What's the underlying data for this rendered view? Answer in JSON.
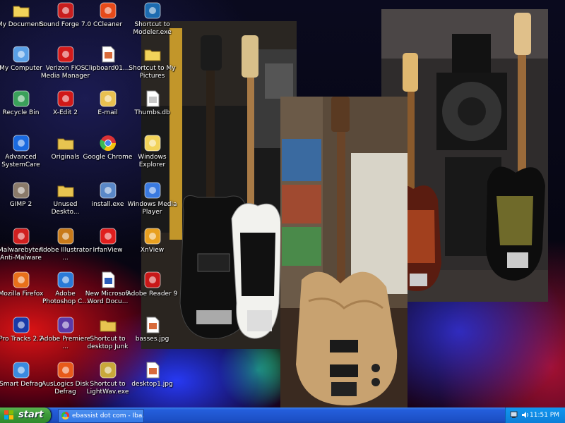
{
  "desktop": {
    "icons": [
      {
        "name": "my-documents",
        "label": "My Documents",
        "icon": "folder-docs-icon"
      },
      {
        "name": "sound-forge",
        "label": "Sound Forge 7.0",
        "icon": "sound-forge-icon"
      },
      {
        "name": "ccleaner",
        "label": "CCleaner",
        "icon": "ccleaner-icon"
      },
      {
        "name": "modeler-shortcut",
        "label": "Shortcut to Modeler.exe",
        "icon": "modeler-icon"
      },
      {
        "name": "my-computer",
        "label": "My Computer",
        "icon": "computer-icon"
      },
      {
        "name": "verizon-fios",
        "label": "Verizon FiOS Media Manager",
        "icon": "verizon-icon"
      },
      {
        "name": "clipboard",
        "label": "Clipboard01....",
        "icon": "image-file-icon"
      },
      {
        "name": "my-pictures-shortcut",
        "label": "Shortcut to My Pictures",
        "icon": "folder-pictures-icon"
      },
      {
        "name": "recycle-bin",
        "label": "Recycle Bin",
        "icon": "recycle-bin-icon"
      },
      {
        "name": "x-edit",
        "label": "X-Edit 2",
        "icon": "x-edit-icon"
      },
      {
        "name": "email",
        "label": "E-mail",
        "icon": "email-icon"
      },
      {
        "name": "thumbs-db",
        "label": "Thumbs.db",
        "icon": "db-file-icon"
      },
      {
        "name": "advanced-systemcare",
        "label": "Advanced SystemCare",
        "icon": "systemcare-icon"
      },
      {
        "name": "originals",
        "label": "Originals",
        "icon": "folder-icon"
      },
      {
        "name": "google-chrome",
        "label": "Google Chrome",
        "icon": "chrome-icon"
      },
      {
        "name": "windows-explorer",
        "label": "Windows Explorer",
        "icon": "explorer-icon"
      },
      {
        "name": "gimp",
        "label": "GIMP 2",
        "icon": "gimp-icon"
      },
      {
        "name": "unused-desktop",
        "label": "Unused Deskto...",
        "icon": "folder-icon"
      },
      {
        "name": "install-exe",
        "label": "install.exe",
        "icon": "installer-icon"
      },
      {
        "name": "windows-media-player",
        "label": "Windows Media Player",
        "icon": "media-player-icon"
      },
      {
        "name": "malwarebytes",
        "label": "Malwarebytes' Anti-Malware",
        "icon": "malwarebytes-icon"
      },
      {
        "name": "adobe-illustrator",
        "label": "Adobe Illustrator ...",
        "icon": "illustrator-icon"
      },
      {
        "name": "irfanview",
        "label": "IrfanView",
        "icon": "irfanview-icon"
      },
      {
        "name": "xnview",
        "label": "XnView",
        "icon": "xnview-icon"
      },
      {
        "name": "mozilla-firefox",
        "label": "Mozilla Firefox",
        "icon": "firefox-icon"
      },
      {
        "name": "adobe-photoshop",
        "label": "Adobe Photoshop C...",
        "icon": "photoshop-icon"
      },
      {
        "name": "new-word-doc",
        "label": "New Microsoft Word Docu...",
        "icon": "word-doc-icon"
      },
      {
        "name": "adobe-reader",
        "label": "Adobe Reader 9",
        "icon": "adobe-reader-icon"
      },
      {
        "name": "pro-tracks",
        "label": "Pro Tracks 2.2",
        "icon": "pro-tracks-icon"
      },
      {
        "name": "adobe-premiere",
        "label": "Adobe Premiere ...",
        "icon": "premiere-icon"
      },
      {
        "name": "desktop-junk-shortcut",
        "label": "Shortcut to desktop Junk",
        "icon": "folder-icon"
      },
      {
        "name": "basses-jpg",
        "label": "basses.jpg",
        "icon": "image-file-icon"
      },
      {
        "name": "smart-defrag",
        "label": "Smart Defrag",
        "icon": "smart-defrag-icon"
      },
      {
        "name": "auslogics-defrag",
        "label": "AusLogics Disk Defrag",
        "icon": "auslogics-icon"
      },
      {
        "name": "lightwav-shortcut",
        "label": "Shortcut to LightWav.exe",
        "icon": "lightwave-icon"
      },
      {
        "name": "desktop1-jpg",
        "label": "desktop1.jpg",
        "icon": "image-file-icon"
      }
    ]
  },
  "taskbar": {
    "start_label": "start",
    "tasks": [
      {
        "label": "ebassist dot com - Iba...",
        "icon": "chrome-icon"
      }
    ],
    "tray": {
      "clock": "11:51 PM",
      "icons": [
        "network-icon",
        "volume-icon"
      ]
    }
  },
  "colors": {
    "taskbar_blue": "#245edc",
    "start_green": "#3c9a3a",
    "tray_blue": "#0c7fd8"
  }
}
